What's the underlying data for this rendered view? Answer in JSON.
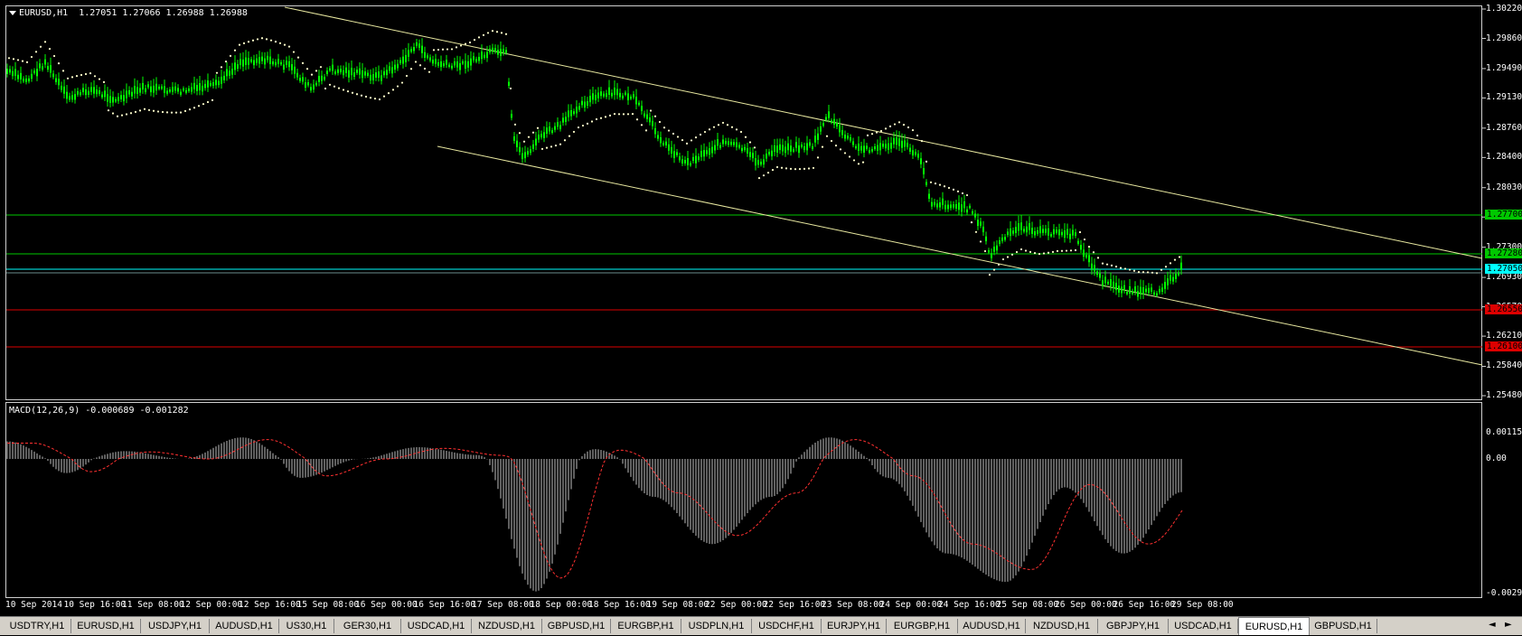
{
  "chart_header": {
    "symbol_line": "EURUSD,H1  1.27051 1.27066 1.26988 1.26988"
  },
  "macd_header": {
    "label": "MACD(12,26,9) -0.000689 -0.001282"
  },
  "price_axis": [
    "1.30220",
    "1.29860",
    "1.29490",
    "1.29130",
    "1.28760",
    "1.28400",
    "1.28030",
    "1.27670",
    "1.27300",
    "1.26930",
    "1.26570",
    "1.26210",
    "1.25840",
    "1.25480"
  ],
  "macd_axis": {
    "top": "0.001154",
    "zero": "0.00",
    "bottom": "-0.002903"
  },
  "level_tags": {
    "green_1": "1.27700",
    "green_2": "1.27280",
    "current": "1.27050",
    "red_1": "1.26550",
    "red_2": "1.26100"
  },
  "time_axis": [
    "10 Sep 2014",
    "10 Sep 16:00",
    "11 Sep 08:00",
    "12 Sep 00:00",
    "12 Sep 16:00",
    "15 Sep 08:00",
    "16 Sep 00:00",
    "16 Sep 16:00",
    "17 Sep 08:00",
    "18 Sep 00:00",
    "18 Sep 16:00",
    "19 Sep 08:00",
    "22 Sep 00:00",
    "22 Sep 16:00",
    "23 Sep 08:00",
    "24 Sep 00:00",
    "24 Sep 16:00",
    "25 Sep 08:00",
    "26 Sep 00:00",
    "26 Sep 16:00",
    "29 Sep 08:00"
  ],
  "tabs": [
    "USDTRY,H1",
    "EURUSD,H1",
    "USDJPY,H1",
    "AUDUSD,H1",
    "US30,H1",
    "GER30,H1",
    "USDCAD,H1",
    "NZDUSD,H1",
    "GBPUSD,H1",
    "EURGBP,H1",
    "USDPLN,H1",
    "USDCHF,H1",
    "EURJPY,H1",
    "EURGBP,H1",
    "AUDUSD,H1",
    "NZDUSD,H1",
    "GBPJPY,H1",
    "USDCAD,H1",
    "EURUSD,H1",
    "GBPUSD,H1"
  ],
  "active_tab_index": 18,
  "tab_nav": {
    "left": "◄",
    "right": "►"
  },
  "colors": {
    "background": "#000000",
    "candles": "#00ff00",
    "sar": "#ffffcc",
    "channel": "#e8e8a0",
    "green_level": "#00c800",
    "red_level": "#dd0000",
    "current_price": "#00ffff",
    "macd_hist": "#c0c0c0",
    "macd_signal": "#ff3030"
  },
  "chart_data": [
    {
      "type": "line",
      "title": "EURUSD,H1",
      "x": [
        "10 Sep 2014",
        "10 Sep 16:00",
        "11 Sep 08:00",
        "12 Sep 00:00",
        "12 Sep 16:00",
        "15 Sep 08:00",
        "16 Sep 00:00",
        "16 Sep 16:00",
        "17 Sep 08:00",
        "18 Sep 00:00",
        "18 Sep 16:00",
        "19 Sep 08:00",
        "22 Sep 00:00",
        "22 Sep 16:00",
        "23 Sep 08:00",
        "24 Sep 00:00",
        "24 Sep 16:00",
        "25 Sep 08:00",
        "26 Sep 00:00",
        "26 Sep 16:00",
        "29 Sep 08:00"
      ],
      "series": [
        {
          "name": "EURUSD",
          "values": [
            1.2945,
            1.293,
            1.292,
            1.2935,
            1.296,
            1.293,
            1.295,
            1.298,
            1.296,
            1.2845,
            1.292,
            1.29,
            1.2845,
            1.286,
            1.2895,
            1.285,
            1.279,
            1.2735,
            1.276,
            1.269,
            1.2705
          ]
        }
      ],
      "ylim": [
        1.2548,
        1.3022
      ],
      "levels": [
        1.277,
        1.2728,
        1.2705,
        1.2655,
        1.261
      ]
    },
    {
      "type": "bar",
      "title": "MACD(12,26,9)",
      "x": [
        "10 Sep 2014",
        "10 Sep 16:00",
        "11 Sep 08:00",
        "12 Sep 00:00",
        "12 Sep 16:00",
        "15 Sep 08:00",
        "16 Sep 00:00",
        "16 Sep 16:00",
        "17 Sep 08:00",
        "18 Sep 00:00",
        "18 Sep 16:00",
        "19 Sep 08:00",
        "22 Sep 00:00",
        "22 Sep 16:00",
        "23 Sep 08:00",
        "24 Sep 00:00",
        "24 Sep 16:00",
        "25 Sep 08:00",
        "26 Sep 00:00",
        "26 Sep 16:00",
        "29 Sep 08:00"
      ],
      "series": [
        {
          "name": "MACD",
          "values": [
            0.0009,
            -0.0003,
            0.0004,
            0.0,
            0.0011,
            -0.0004,
            0.0,
            0.0006,
            0.0002,
            -0.0028,
            0.0005,
            -0.0008,
            -0.0018,
            -0.0008,
            0.0011,
            -0.0004,
            -0.002,
            -0.0026,
            -0.0006,
            -0.002,
            -0.0007
          ]
        }
      ],
      "ylim": [
        -0.002903,
        0.001154
      ]
    }
  ]
}
